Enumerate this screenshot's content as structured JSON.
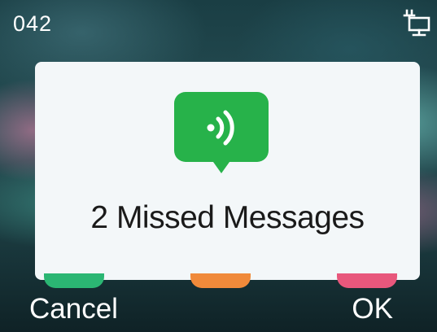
{
  "status_bar": {
    "account": "042",
    "network_icon": "wired-network-icon"
  },
  "dialog": {
    "icon": "voicemail-message-icon",
    "icon_color": "#27b24a",
    "title": "2 Missed Messages"
  },
  "softkeys": {
    "left_label": "Cancel",
    "right_label": "OK"
  },
  "colors": {
    "dialog_bg": "#f3f7f9",
    "key_green": "#2bb673",
    "key_orange": "#f08a3a",
    "key_red": "#e8577c"
  }
}
